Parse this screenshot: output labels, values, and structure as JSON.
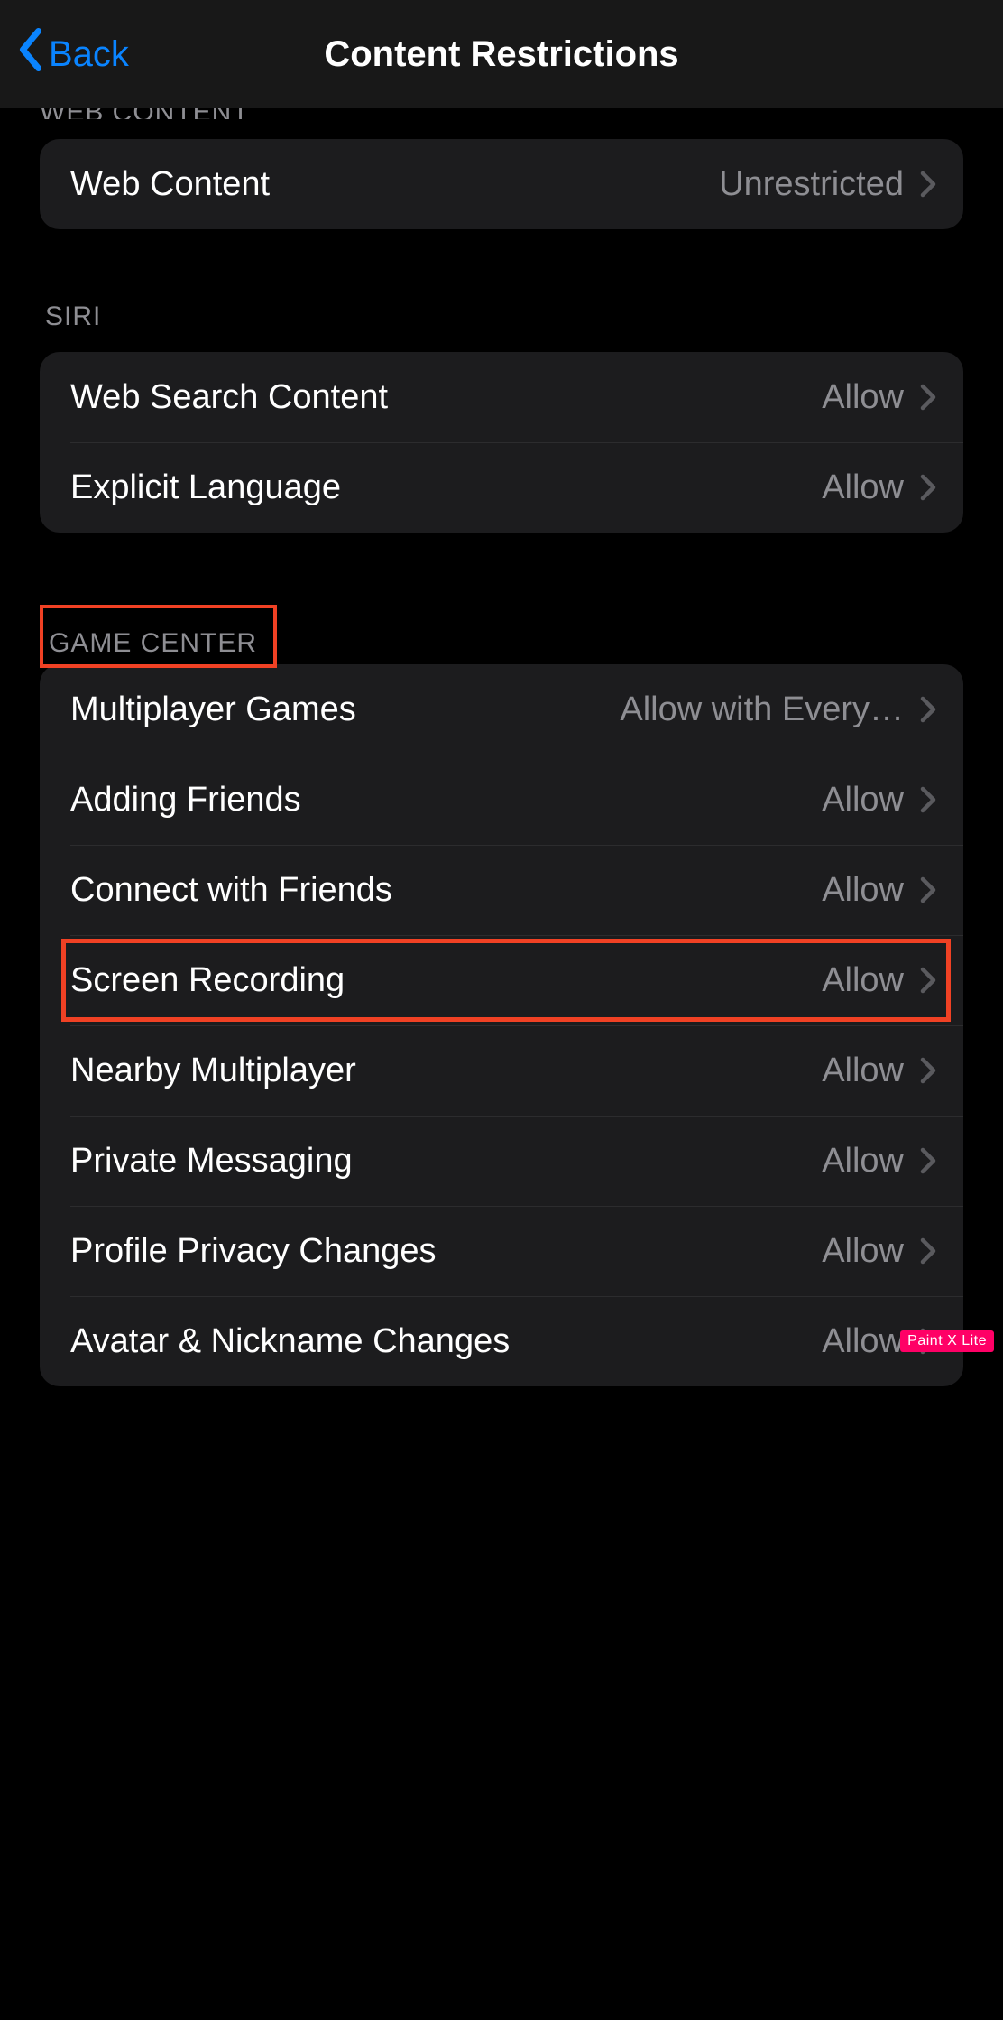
{
  "nav": {
    "back_label": "Back",
    "title": "Content Restrictions"
  },
  "sections": {
    "web_content": {
      "header": "WEB CONTENT",
      "items": [
        {
          "label": "Web Content",
          "value": "Unrestricted"
        }
      ]
    },
    "siri": {
      "header": "SIRI",
      "items": [
        {
          "label": "Web Search Content",
          "value": "Allow"
        },
        {
          "label": "Explicit Language",
          "value": "Allow"
        }
      ]
    },
    "game_center": {
      "header": "GAME CENTER",
      "items": [
        {
          "label": "Multiplayer Games",
          "value": "Allow with Every…"
        },
        {
          "label": "Adding Friends",
          "value": "Allow"
        },
        {
          "label": "Connect with Friends",
          "value": "Allow"
        },
        {
          "label": "Screen Recording",
          "value": "Allow"
        },
        {
          "label": "Nearby Multiplayer",
          "value": "Allow"
        },
        {
          "label": "Private Messaging",
          "value": "Allow"
        },
        {
          "label": "Profile Privacy Changes",
          "value": "Allow"
        },
        {
          "label": "Avatar & Nickname Changes",
          "value": "Allow"
        }
      ]
    }
  },
  "watermark": "Paint X Lite"
}
